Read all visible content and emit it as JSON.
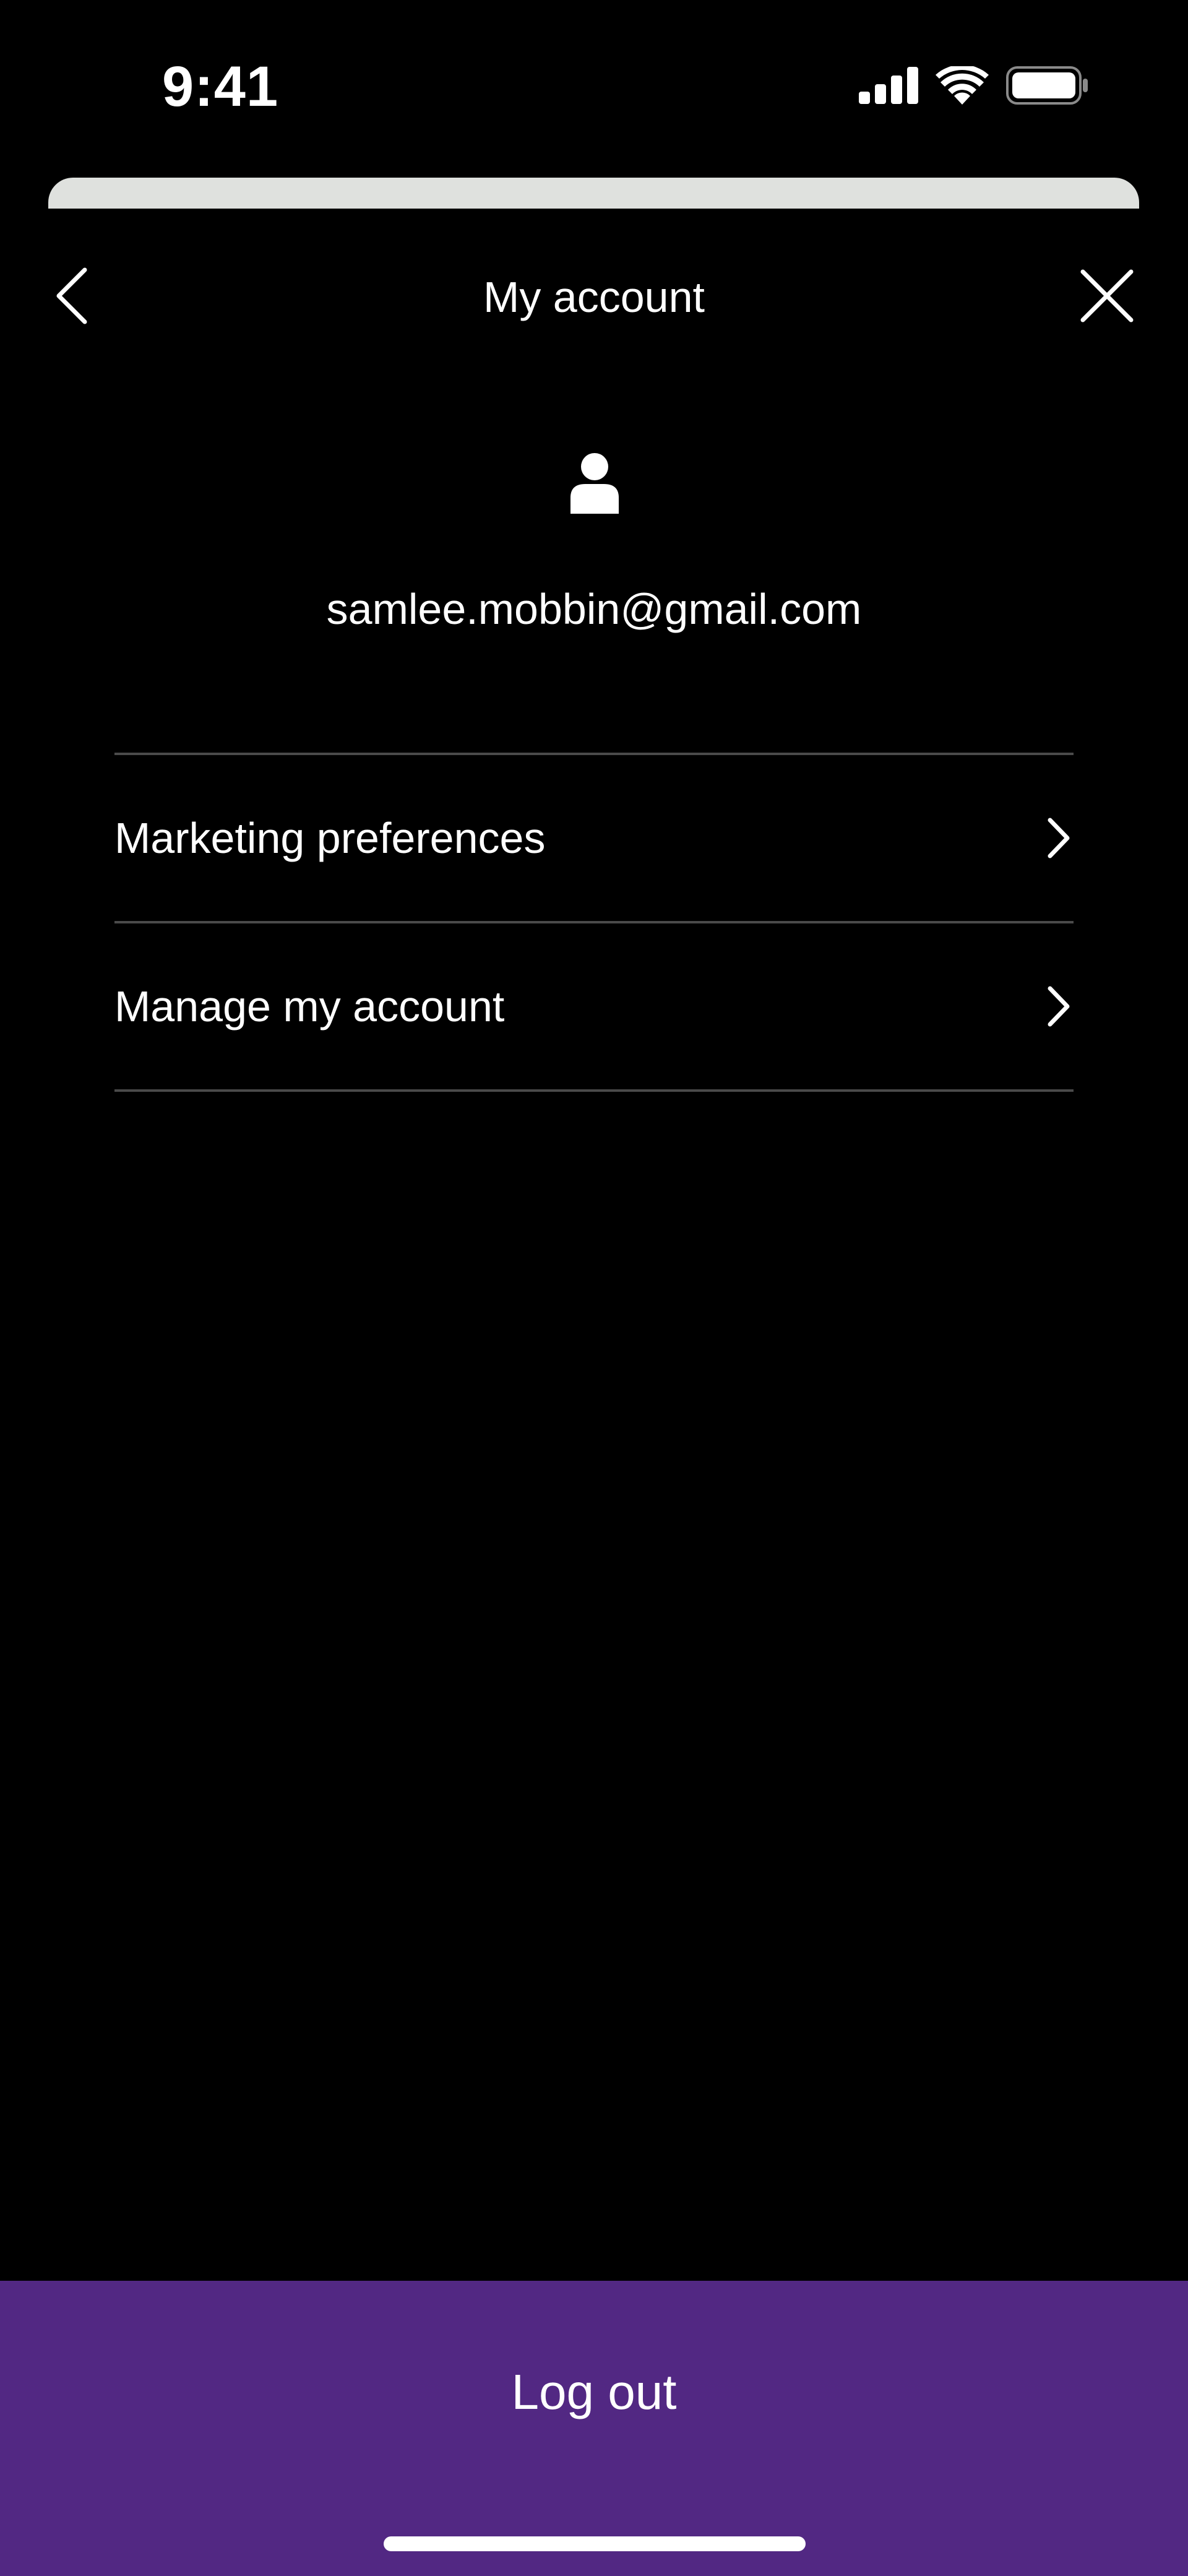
{
  "status_bar": {
    "time": "9:41",
    "icons": [
      "cellular-signal-icon",
      "wifi-icon",
      "battery-icon"
    ]
  },
  "header": {
    "title": "My account",
    "back_icon": "chevron-left-icon",
    "close_icon": "close-icon"
  },
  "profile": {
    "icon": "user-icon",
    "email": "samlee.mobbin@gmail.com"
  },
  "menu": {
    "items": [
      {
        "label": "Marketing preferences",
        "icon": "chevron-right-icon"
      },
      {
        "label": "Manage my account",
        "icon": "chevron-right-icon"
      }
    ]
  },
  "footer": {
    "logout_label": "Log out"
  },
  "colors": {
    "background": "#000000",
    "text": "#ffffff",
    "divider": "#4a4a4a",
    "sheet_edge": "#dfe1de",
    "brand_purple": "#522883"
  }
}
